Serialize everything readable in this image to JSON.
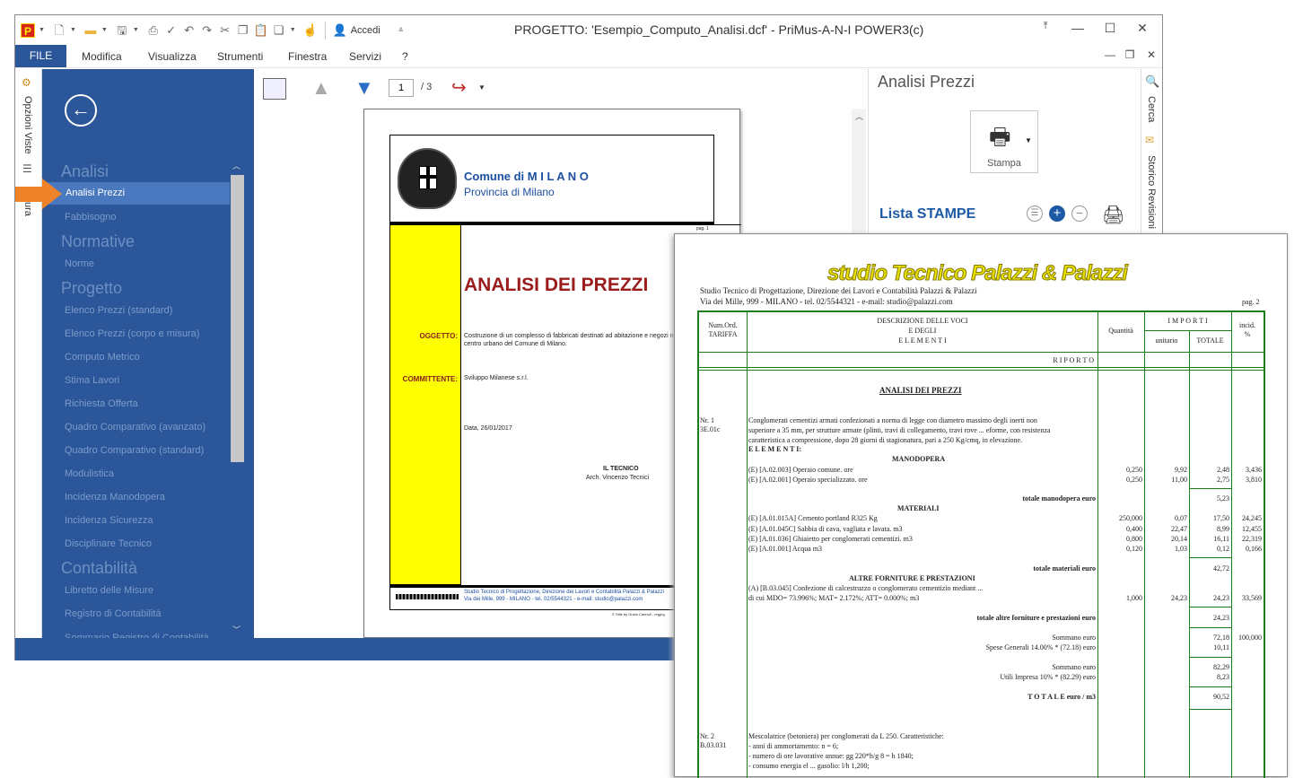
{
  "window": {
    "title": "PROGETTO: 'Esempio_Computo_Analisi.dcf' - PriMus-A-N-I    POWER3(c)",
    "login_label": "Accedi"
  },
  "menu": {
    "file": "FILE",
    "items": [
      "Modifica",
      "Visualizza",
      "Strumenti",
      "Finestra",
      "Servizi",
      "?"
    ]
  },
  "left_strip": {
    "tab1": "Opzioni Viste",
    "tab2": "ura"
  },
  "nav": {
    "sections": [
      {
        "title": "Analisi",
        "items": [
          "Analisi Prezzi",
          "Fabbisogno"
        ]
      },
      {
        "title": "Normative",
        "items": [
          "Norme"
        ]
      },
      {
        "title": "Progetto",
        "items": [
          "Elenco Prezzi (standard)",
          "Elenco Prezzi (corpo e misura)",
          "Computo Metrico",
          "Stima Lavori",
          "Richiesta Offerta",
          "Quadro Comparativo (avanzato)",
          "Quadro Comparativo (standard)",
          "Modulistica",
          "Incidenza Manodopera",
          "Incidenza Sicurezza",
          "Disciplinare Tecnico"
        ]
      },
      {
        "title": "Contabilità",
        "items": [
          "Libretto delle Misure",
          "Registro di Contabilità",
          "Sommario Registro di Contabilità"
        ]
      }
    ]
  },
  "viewer": {
    "page_input": "1",
    "page_total": "/ 3"
  },
  "page1": {
    "city": "Comune di M I L A N O",
    "province": "Provincia di Milano",
    "pag": "pag. 1",
    "heading": "ANALISI DEI PREZZI",
    "oggetto_label": "OGGETTO:",
    "oggetto": "Costruzione di un complesso di fabbricati destinati ad abitazione e negozi nel centro urbano del Comune di Milano.",
    "committente_label": "COMMITTENTE:",
    "committente": "Sviluppo Milanese s.r.l.",
    "data": "Data, 26/01/2017",
    "tecnico_label": "IL TECNICO",
    "tecnico": "Arch. Vincenzo Tecnici",
    "footer1": "Studio Tecnico di Progettazione, Direzione dei Lavori e Contabilità Palazzi & Palazzi",
    "footer2": "Via dei Mille, 999 - MILANO - tel. 02/5544321 - e-mail: studio@palazzi.com",
    "footer_small": "© Stile by Guido Cannoli - regprg"
  },
  "right_panel": {
    "title": "Analisi Prezzi",
    "stampa": "Stampa",
    "lista": "Lista STAMPE"
  },
  "right_strip": {
    "tab1": "Cerca",
    "tab2": "Storico Revisioni"
  },
  "page2": {
    "logo": "studio Tecnico Palazzi & Palazzi",
    "studio1": "Studio Tecnico di Progettazione, Direzione dei Lavori e Contabilità Palazzi & Palazzi",
    "studio2": "Via dei Mille, 999 - MILANO - tel. 02/5544321 -  e-mail: studio@palazzi.com",
    "pag": "pag. 2",
    "h_num": "Num.Ord.",
    "h_tar": "TARIFFA",
    "h_desc1": "DESCRIZIONE DELLE VOCI",
    "h_desc2": "E DEGLI",
    "h_desc3": "E L E M E N T I",
    "h_qta": "Quantità",
    "h_imp": "I M P O R T I",
    "h_unit": "unitario",
    "h_tot": "TOTALE",
    "h_inc1": "incid.",
    "h_inc2": "%",
    "riporto": "R I P O R T O",
    "analisi_title": "ANALISI DEI PREZZI",
    "nr1": "Nr. 1",
    "tar1": "3E.01c",
    "desc1a": "Conglomerati cementizi armati confezionati a norma di legge con diametro massimo degli inerti non",
    "desc1b": "superiore a 35 mm, per strutture armate (plinti, travi di collegamento, travi rove ... eforme, con resistenza",
    "desc1c": "caratteristica a compressione, dopo 28 giorni di stagionatura, pari a 250 Kg/cmq, in elevazione.",
    "elementi": "E L E M E N T I:",
    "manodopera": "MANODOPERA",
    "r1": {
      "d": "(E) [A.02.003] Operaio comune. ore",
      "q": "0,250",
      "u": "9,92",
      "t": "2,48",
      "i": "3,436"
    },
    "r2": {
      "d": "(E) [A.02.001] Operaio specializzato. ore",
      "q": "0,250",
      "u": "11,00",
      "t": "2,75",
      "i": "3,810"
    },
    "tot_mano": "totale manodopera euro",
    "tot_mano_v": "5,23",
    "materiali": "MATERIALI",
    "r3": {
      "d": "(E) [A.01.015A] Cemento portland R325 Kg",
      "q": "250,000",
      "u": "0,07",
      "t": "17,50",
      "i": "24,245"
    },
    "r4": {
      "d": "(E) [A.01.045C] Sabbia di cava, vagliata e lavata. m3",
      "q": "0,400",
      "u": "22,47",
      "t": "8,99",
      "i": "12,455"
    },
    "r5": {
      "d": "(E) [A.01.036] Ghiaietto per conglomerati cementizi. m3",
      "q": "0,800",
      "u": "20,14",
      "t": "16,11",
      "i": "22,319"
    },
    "r6": {
      "d": "(E) [A.01.001] Acqua m3",
      "q": "0,120",
      "u": "1,03",
      "t": "0,12",
      "i": "0,166"
    },
    "tot_mat": "totale materiali euro",
    "tot_mat_v": "42,72",
    "altre": "ALTRE FORNITURE E PRESTAZIONI",
    "r7a": "(A) [B.03.045] Confezione di calcestruzzo o conglomerato cementizio mediant ...",
    "r7": {
      "d": "di cui MDO= 73.996%; MAT= 2.172%; ATT= 0.000%; m3",
      "q": "1,000",
      "u": "24,23",
      "t": "24,23",
      "i": "33,569"
    },
    "tot_altre": "totale altre forniture e prestazioni euro",
    "tot_altre_v": "24,23",
    "sommano1": "Sommano euro",
    "sommano1_v": "72,18",
    "sommano1_i": "100,000",
    "spese": "Spese Generali 14.00% * (72.18)  euro",
    "spese_v": "10,11",
    "sommano2": "Sommano euro",
    "sommano2_v": "82,29",
    "utili": "Utili Impresa 10% * (82.29)  euro",
    "utili_v": "8,23",
    "totale": "T O T A L E  euro / m3",
    "totale_v": "90,52",
    "nr2": "Nr. 2",
    "tar2": "B.03.031",
    "desc2a": "Mescolatrice (betoniera) per conglomerati da L 250. Caratteristiche:",
    "desc2b": "- anni di ammortamento: n = 6;",
    "desc2c": "- numero di ore lavorative annue: gg 220*h/g 8 = h 1840;",
    "desc2d": "- consumo energia el ...   gasolio: l/h 1,200;"
  },
  "colors": {
    "accent": "#2b579a",
    "yellow": "#ffff00",
    "green_rule": "#1a7f1a",
    "heading_red": "#9b1c1c",
    "logo_yellow": "#e5e000"
  }
}
